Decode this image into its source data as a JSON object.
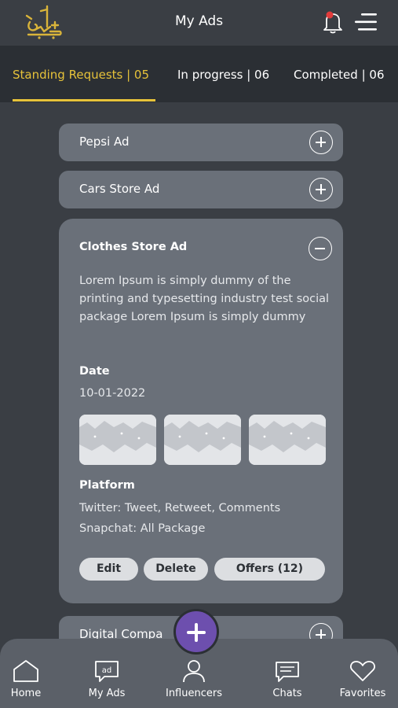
{
  "header": {
    "title": "My Ads",
    "logo_icon": "arabic-calligraphy-logo",
    "notification_icon": "bell-icon",
    "menu_icon": "menu-icon",
    "notification_dot_color": "#e23b3b"
  },
  "tabs": [
    {
      "label": "Standing Requests | 05",
      "active": true
    },
    {
      "label": "In progress | 06",
      "active": false
    },
    {
      "label": "Completed | 06",
      "active": false
    }
  ],
  "colors": {
    "accent": "#e6c23a",
    "card": "#6a7079",
    "fab": "#6d4fae",
    "background": "#3a3e44"
  },
  "ads": {
    "pepsi": {
      "title": "Pepsi Ad"
    },
    "cars": {
      "title": "Cars Store Ad"
    },
    "clothes": {
      "title": "Clothes Store Ad",
      "description": "Lorem Ipsum is simply dummy of the printing and typesetting industry test social package Lorem Ipsum is simply dummy",
      "date_label": "Date",
      "date_value": "10-01-2022",
      "platform_label": "Platform",
      "platform_lines": [
        "Twitter: Tweet, Retweet, Comments",
        "Snapchat: All Package"
      ],
      "edit_label": "Edit",
      "delete_label": "Delete",
      "offers_label": "Offers (12)"
    },
    "digital": {
      "title": "Digital Compa"
    }
  },
  "bottom_nav": [
    {
      "label": "Home",
      "icon": "home-icon"
    },
    {
      "label": "My Ads",
      "icon": "ad-icon"
    },
    {
      "label": "Influencers",
      "icon": "user-icon"
    },
    {
      "label": "Chats",
      "icon": "chat-icon"
    },
    {
      "label": "Favorites",
      "icon": "heart-icon"
    }
  ],
  "fab_icon": "plus-icon"
}
